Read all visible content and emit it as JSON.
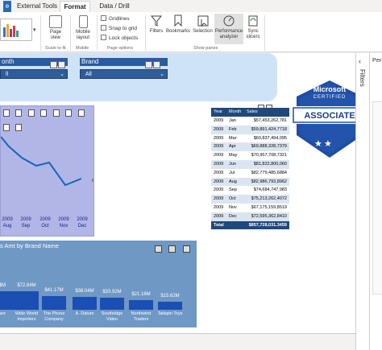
{
  "ribbon_tabs": [
    "External Tools",
    "Format",
    "Data / Drill"
  ],
  "ribbon": {
    "page_view": "Page\nview",
    "mobile_layout": "Mobile\nlayout",
    "gridlines": "Gridlines",
    "snap_to_grid": "Snap to grid",
    "lock_objects": "Lock objects",
    "filters": "Filters",
    "bookmarks": "Bookmarks",
    "selection": "Selection",
    "performance_analyzer": "Performance\nanalyzer",
    "sync_slicers": "Sync\nslicers",
    "group_scale": "Scale to fit",
    "group_mobile": "Mobile",
    "group_page_options": "Page options",
    "group_show_panes": "Show panes"
  },
  "slicers": {
    "month": {
      "title": "onth",
      "value": "ll"
    },
    "brand": {
      "title": "Brand",
      "value": "All"
    }
  },
  "line_chart": {
    "x_labels": [
      {
        "year": "2009",
        "mon": "Aug"
      },
      {
        "year": "2009",
        "mon": "Sep"
      },
      {
        "year": "2009",
        "mon": "Oct"
      },
      {
        "year": "2009",
        "mon": "Nov"
      },
      {
        "year": "2009",
        "mon": "Dec"
      }
    ]
  },
  "table": {
    "headers": [
      "Year",
      "Month",
      "Sales"
    ],
    "rows": [
      [
        "2009",
        "Jan",
        "$57,453,262,781"
      ],
      [
        "2009",
        "Feb",
        "$59,891,424,7718"
      ],
      [
        "2009",
        "Mar",
        "$60,837,494,095"
      ],
      [
        "2009",
        "Apr",
        "$69,888,328,7379"
      ],
      [
        "2009",
        "May",
        "$70,957,708,7321"
      ],
      [
        "2009",
        "Jun",
        "$81,822,800,060"
      ],
      [
        "2009",
        "Jul",
        "$82,779,485,6884"
      ],
      [
        "2009",
        "Aug",
        "$82,986,793,8962"
      ],
      [
        "2009",
        "Sep",
        "$74,684,747,983"
      ],
      [
        "2009",
        "Oct",
        "$75,213,262,4072"
      ],
      [
        "2009",
        "Nov",
        "$67,175,159,8519"
      ],
      [
        "2009",
        "Dec",
        "$72,595,362,8410"
      ]
    ],
    "total_label": "Total",
    "total_value": "$857,728,031.3459"
  },
  "bar_chart": {
    "title": "s Amt by Brand Name",
    "bars": [
      {
        "label": "$M",
        "name": "are"
      },
      {
        "label": "$72.84M",
        "name": "Wide World\nImporters"
      },
      {
        "label": "$41.17M",
        "name": "The Phone\nCompany"
      },
      {
        "label": "$38.04M",
        "name": "A. Datum"
      },
      {
        "label": "$33.92M",
        "name": "Southridge\nVideo"
      },
      {
        "label": "$21.16M",
        "name": "Northwind\nTraders"
      },
      {
        "label": "$15.62M",
        "name": "Tailspin Toys"
      }
    ]
  },
  "badge": {
    "brand": "Microsoft",
    "certified": "CERTIFIED",
    "level": "ASSOCIATE"
  },
  "right_pane": {
    "filters_label": "Filters",
    "perf_label": "Per"
  },
  "colors": {
    "accent": "#2a5b9e",
    "table_header": "#1f497d",
    "line_chart_bg": "#b2b6e6",
    "bar_chart_bg": "#6f98c4",
    "bar": "#1b4fb3"
  }
}
